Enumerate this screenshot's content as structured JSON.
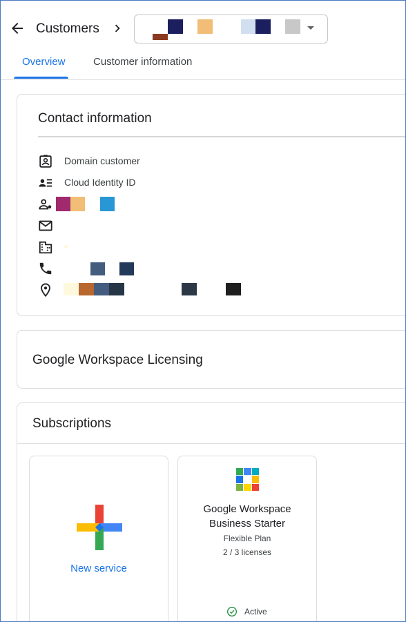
{
  "header": {
    "back_icon": "arrow-back-icon",
    "title": "Customers",
    "breadcrumb_icon": "chevron-right-icon",
    "customer_picker": {
      "icon": "dropdown-caret-icon"
    }
  },
  "tabs": [
    {
      "label": "Overview",
      "active": true
    },
    {
      "label": "Customer information",
      "active": false
    }
  ],
  "contact": {
    "title": "Contact information",
    "rows": [
      {
        "icon": "contact-card-icon",
        "label": "Domain customer"
      },
      {
        "icon": "badge-list-icon",
        "label": "Cloud Identity ID"
      },
      {
        "icon": "person-settings-icon",
        "label": ""
      },
      {
        "icon": "email-icon",
        "label": ""
      },
      {
        "icon": "building-icon",
        "label": ""
      },
      {
        "icon": "phone-icon",
        "label": ""
      },
      {
        "icon": "location-pin-icon",
        "label": ""
      }
    ]
  },
  "licensing": {
    "title": "Google Workspace Licensing"
  },
  "subscriptions": {
    "title": "Subscriptions",
    "new_service": {
      "label": "New service",
      "icon": "plus-colored-icon"
    },
    "product": {
      "name_line1": "Google Workspace",
      "name_line2": "Business Starter",
      "plan": "Flexible Plan",
      "licenses": "2 / 3 licenses",
      "status": "Active",
      "icon": "workspace-logo-icon",
      "status_icon": "check-circle-icon"
    }
  },
  "colors": {
    "accent": "#1a73e8",
    "active_green": "#1e8e3e"
  }
}
